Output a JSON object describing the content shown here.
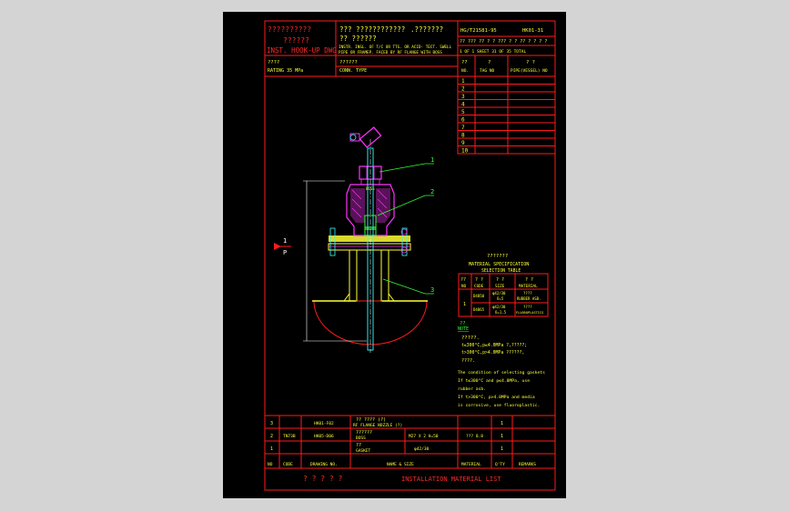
{
  "title_block": {
    "q1": "??????????",
    "q2": "??????",
    "drawing_type": "INST. HOOK-UP DWG",
    "desc_q": "??? ????????????",
    "desc_q2": "?? ??????",
    "desc_line1": "INSTR. INSL. OF T/C OR TTG. OR ACID- TECT. SWELL",
    "desc_line2": "PIPE OR FRAMEP. FACED BY RF FLANGE WITH BOSS",
    "q3": ".???????",
    "std_no": "HG/T21581-95",
    "dwg_no": "HK01-31",
    "sheet_row1": "?? ???   ?? ? ? ??? ? ? ??  ? ? ? ?",
    "sheet_row2": "1  OF 1  SHEET  31 OF 35 TOTAL",
    "rating_q": "????",
    "rating": "RATING   35 MPa",
    "conn_q": "??????",
    "conn_type": "CONN. TYPE"
  },
  "tag_table": {
    "header_q": [
      "??",
      "?",
      "? ?"
    ],
    "header": [
      "NO.",
      "TAG NO",
      "PIPE(VESSEL) NO"
    ],
    "rows": [
      "1",
      "2",
      "3",
      "4",
      "5",
      "6",
      "7",
      "8",
      "9",
      "10"
    ]
  },
  "drawing": {
    "label_1": "1",
    "label_2": "2",
    "label_3": "3",
    "label_p1": "1",
    "label_p2": "P",
    "boss_text": "BOSS"
  },
  "material_spec": {
    "title_q": "???????",
    "title1": "MATERIAL SPECIFICATION",
    "title2": "SELECTION TABLE",
    "header_q": [
      "??",
      "? ?",
      "? ?",
      "? ?"
    ],
    "header": [
      "NO",
      "CODE",
      "SIZE",
      "MATERIAL"
    ],
    "row_no": "1",
    "row1": [
      "D4850",
      "φ42/30",
      "????"
    ],
    "row1b": [
      "",
      "δ=5",
      "RUBBER ASB."
    ],
    "row2": [
      "D4865",
      "φ42/30",
      "????"
    ],
    "row2b": [
      "",
      "δ=1.5",
      "FLUOROPLASTICS"
    ]
  },
  "notes": {
    "head_q": "??",
    "head": "NOTE",
    "lines_q": [
      "?????.",
      "  t≤300°C,p≤4.0MPa ?,?????;",
      "  t>300°C,p>4.0MPa  ??????,",
      "  ????."
    ],
    "lines_en": [
      "The condition of selecting gaskets",
      "  If t≤300°C and p≤4.0MPa, use",
      "  rubber asb.",
      "  If t>300°C, p>4.0MPa and media",
      "  is corrosive, use fluoroplastic."
    ]
  },
  "bom": {
    "rows": [
      {
        "no": "3",
        "code": "",
        "dwg": "HK01-F02",
        "name_q": "?? ???? (?)",
        "name": "RF FLANGE NOZZLE (?)",
        "size": "",
        "mat": "",
        "qty": "1"
      },
      {
        "no": "2",
        "code": "TN73B",
        "dwg": "HK05-D06",
        "name_q": "??????",
        "name": "BOSS",
        "size": "M27 X 2  H=50",
        "mat": "???  8.8",
        "qty": "1"
      },
      {
        "no": "1",
        "code": "",
        "dwg": "",
        "name_q": "??",
        "name": "GASKET",
        "size": "φ42/30",
        "mat": "",
        "qty": "1"
      }
    ],
    "header": [
      "NO",
      "CODE",
      "DRAWING NO.",
      "NAME & SIZE",
      "MATERIAL",
      "Q'TY",
      "REMARKS"
    ],
    "footer_q": "? ? ? ? ?",
    "footer": "INSTALLATION MATERIAL LIST"
  }
}
